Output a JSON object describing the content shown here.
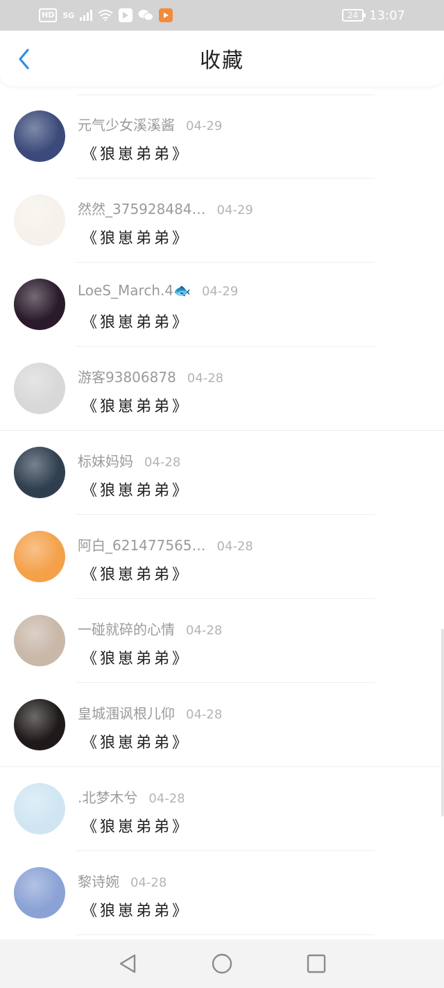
{
  "status_bar": {
    "hd": "HD",
    "signal": "5G",
    "battery": "24",
    "time": "13:07"
  },
  "header": {
    "title": "收藏",
    "back_icon": "chevron-left-icon",
    "accent_color": "#2f8ce6"
  },
  "items": [
    {
      "name": "元气少女溪溪酱",
      "date": "04-29",
      "content": "《狼崽弟弟》",
      "avatar_color": "#3b4a7a"
    },
    {
      "name": "然然_375928484…",
      "date": "04-29",
      "content": "《狼崽弟弟》",
      "avatar_color": "#f6f1ea"
    },
    {
      "name": "LoeS_March.4🐟",
      "date": "04-29",
      "content": "《狼崽弟弟》",
      "avatar_color": "#2a1a2a"
    },
    {
      "name": "游客93806878",
      "date": "04-28",
      "content": "《狼崽弟弟》",
      "avatar_color": "#d8d8d8"
    },
    {
      "name": "标妹妈妈",
      "date": "04-28",
      "content": "《狼崽弟弟》",
      "avatar_color": "#2f3f4f"
    },
    {
      "name": "阿白_621477565…",
      "date": "04-28",
      "content": "《狼崽弟弟》",
      "avatar_color": "#f4a14a"
    },
    {
      "name": "一碰就碎的心情",
      "date": "04-28",
      "content": "《狼崽弟弟》",
      "avatar_color": "#c9b7a8"
    },
    {
      "name": "皇城涠讽根儿仰",
      "date": "04-28",
      "content": "《狼崽弟弟》",
      "avatar_color": "#1f1a1a"
    },
    {
      "name": ".北梦木兮",
      "date": "04-28",
      "content": "《狼崽弟弟》",
      "avatar_color": "#cfe6f2"
    },
    {
      "name": "黎诗婉",
      "date": "04-28",
      "content": "《狼崽弟弟》",
      "avatar_color": "#8aa2d6"
    }
  ],
  "nav": {
    "back_icon": "triangle-back-icon",
    "home_icon": "circle-home-icon",
    "recents_icon": "square-recents-icon"
  }
}
